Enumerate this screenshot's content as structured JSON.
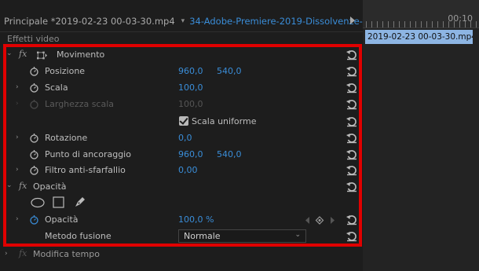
{
  "topbar": {
    "sequence": "Principale *2019-02-23 00-03-30.mp4",
    "dropdown_caret": "▾",
    "clip": "34-Adobe-Premiere-2019-Dissolvenze-v..."
  },
  "timeline": {
    "time": "00:10",
    "clip_label": "2019-02-23 00-03-30.mp4"
  },
  "panel": {
    "header": "Effetti video"
  },
  "effects": {
    "movimento": {
      "label": "Movimento",
      "posizione": {
        "label": "Posizione",
        "x": "960,0",
        "y": "540,0"
      },
      "scala": {
        "label": "Scala",
        "value": "100,0"
      },
      "larghezza": {
        "label": "Larghezza scala",
        "value": "100,0"
      },
      "uniforme": {
        "label": "Scala uniforme",
        "checked": true
      },
      "rotazione": {
        "label": "Rotazione",
        "value": "0,0"
      },
      "ancoraggio": {
        "label": "Punto di ancoraggio",
        "x": "960,0",
        "y": "540,0"
      },
      "filtro": {
        "label": "Filtro anti-sfarfallio",
        "value": "0,00"
      }
    },
    "opacita": {
      "label": "Opacità",
      "opacita": {
        "label": "Opacità",
        "value": "100,0 %"
      },
      "metodo": {
        "label": "Metodo fusione",
        "value": "Normale"
      }
    },
    "modifica_tempo": {
      "label": "Modifica tempo"
    }
  },
  "colors": {
    "accent": "#3a8dd8",
    "highlight": "#e00000",
    "clip": "#8db5e3"
  },
  "icons": [
    "chevron-right-icon",
    "chevron-down-icon",
    "fx-icon",
    "transform-icon",
    "stopwatch-icon",
    "reset-icon",
    "ellipse-mask-icon",
    "rectangle-mask-icon",
    "pen-mask-icon",
    "keyframe-icon",
    "play-icon"
  ]
}
